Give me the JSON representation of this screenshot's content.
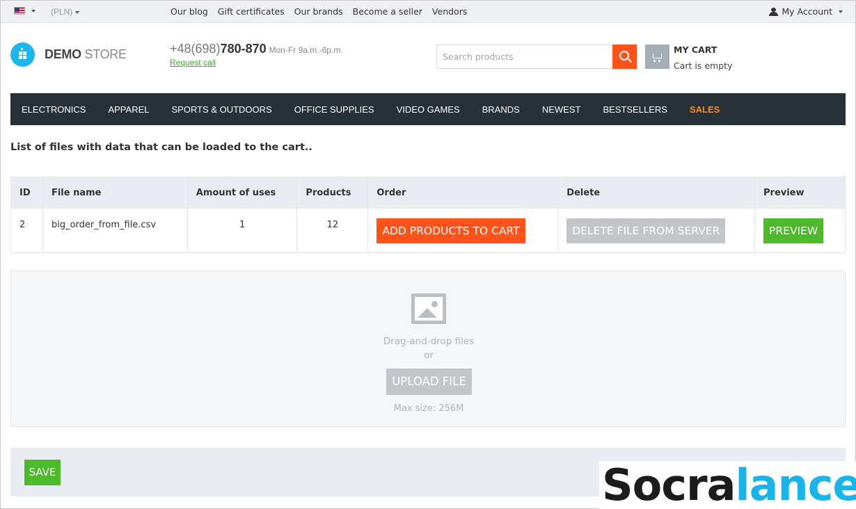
{
  "topbar": {
    "currency": "(PLN)",
    "links": [
      "Our blog",
      "Gift certificates",
      "Our brands",
      "Become a seller",
      "Vendors"
    ],
    "account_label": "My Account"
  },
  "header": {
    "logo_bold": "DEMO",
    "logo_light": "STORE",
    "phone_prefix": "+48(698)",
    "phone_main": "780-870",
    "hours": "Mon-Fr 9a.m.-6p.m.",
    "request_call": "Request call",
    "search_placeholder": "Search products",
    "cart_title": "MY CART",
    "cart_status": "Cart is empty"
  },
  "nav": {
    "items": [
      "ELECTRONICS",
      "APPAREL",
      "SPORTS & OUTDOORS",
      "OFFICE SUPPLIES",
      "VIDEO GAMES",
      "BRANDS",
      "NEWEST",
      "BESTSELLERS"
    ],
    "sales": "SALES",
    "sales_color": "#ff8c1a"
  },
  "main": {
    "title": "List of files with data that can be loaded to the cart..",
    "table": {
      "headers": [
        "ID",
        "File name",
        "Amount of uses",
        "Products",
        "Order",
        "Delete",
        "Preview"
      ],
      "rows": [
        {
          "id": "2",
          "file_name": "big_order_from_file.csv",
          "uses": "1",
          "products": "12",
          "order_label": "ADD PRODUCTS TO CART",
          "delete_label": "DELETE FILE FROM SERVER",
          "preview_label": "PREVIEW"
        }
      ]
    },
    "upload": {
      "dnd_text": "Drag-and-drop files",
      "or_text": "or",
      "button_label": "UPLOAD FILE",
      "max_size": "Max size: 256M"
    },
    "save_label": "SAVE"
  },
  "colors": {
    "accent_orange": "#ff5319",
    "accent_green": "#4cba2b",
    "nav_bg": "#283038",
    "logo_blue": "#1ab6ec"
  },
  "watermark": {
    "part1": "Socra",
    "part2": "lance"
  }
}
